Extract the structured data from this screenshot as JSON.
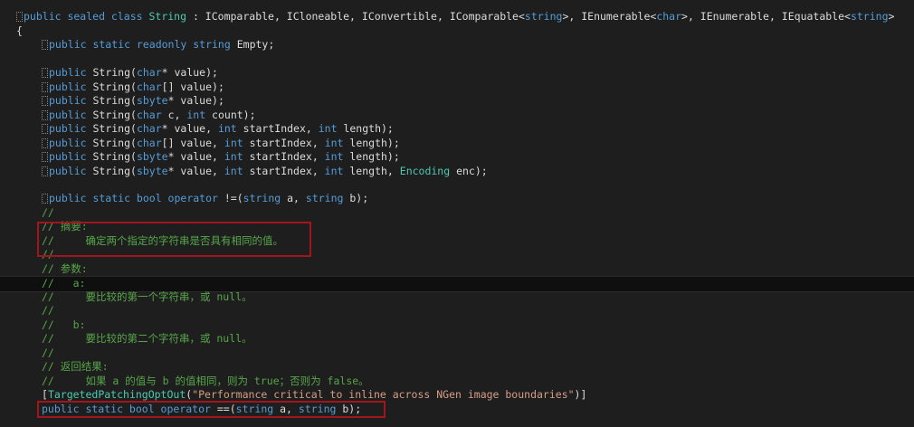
{
  "editor": {
    "lines": [
      {
        "tokens": [
          {
            "t": "public sealed class ",
            "c": "kw"
          },
          {
            "t": "String",
            "c": "type"
          },
          {
            "t": " : IComparable, ICloneable, IConvertible, IComparable<",
            "c": "tx"
          },
          {
            "t": "string",
            "c": "kw"
          },
          {
            "t": ">, IEnumerable<",
            "c": "tx"
          },
          {
            "t": "char",
            "c": "kw"
          },
          {
            "t": ">, IEnumerable, IEquatable<",
            "c": "tx"
          },
          {
            "t": "string",
            "c": "kw"
          },
          {
            "t": ">",
            "c": "tx"
          }
        ]
      },
      {
        "tokens": [
          {
            "t": "{",
            "c": "tx"
          }
        ]
      },
      {
        "tokens": [
          {
            "t": "public static readonly string",
            "c": "kw"
          },
          {
            "t": " Empty;",
            "c": "tx"
          }
        ]
      },
      {
        "tokens": []
      },
      {
        "tokens": [
          {
            "t": "public",
            "c": "kw"
          },
          {
            "t": " String(",
            "c": "tx"
          },
          {
            "t": "char",
            "c": "kw"
          },
          {
            "t": "* value);",
            "c": "tx"
          }
        ]
      },
      {
        "tokens": [
          {
            "t": "public",
            "c": "kw"
          },
          {
            "t": " String(",
            "c": "tx"
          },
          {
            "t": "char",
            "c": "kw"
          },
          {
            "t": "[] value);",
            "c": "tx"
          }
        ]
      },
      {
        "tokens": [
          {
            "t": "public",
            "c": "kw"
          },
          {
            "t": " String(",
            "c": "tx"
          },
          {
            "t": "sbyte",
            "c": "kw"
          },
          {
            "t": "* value);",
            "c": "tx"
          }
        ]
      },
      {
        "tokens": [
          {
            "t": "public",
            "c": "kw"
          },
          {
            "t": " String(",
            "c": "tx"
          },
          {
            "t": "char",
            "c": "kw"
          },
          {
            "t": " c, ",
            "c": "tx"
          },
          {
            "t": "int",
            "c": "kw"
          },
          {
            "t": " count);",
            "c": "tx"
          }
        ]
      },
      {
        "tokens": [
          {
            "t": "public",
            "c": "kw"
          },
          {
            "t": " String(",
            "c": "tx"
          },
          {
            "t": "char",
            "c": "kw"
          },
          {
            "t": "* value, ",
            "c": "tx"
          },
          {
            "t": "int",
            "c": "kw"
          },
          {
            "t": " startIndex, ",
            "c": "tx"
          },
          {
            "t": "int",
            "c": "kw"
          },
          {
            "t": " length);",
            "c": "tx"
          }
        ]
      },
      {
        "tokens": [
          {
            "t": "public",
            "c": "kw"
          },
          {
            "t": " String(",
            "c": "tx"
          },
          {
            "t": "char",
            "c": "kw"
          },
          {
            "t": "[] value, ",
            "c": "tx"
          },
          {
            "t": "int",
            "c": "kw"
          },
          {
            "t": " startIndex, ",
            "c": "tx"
          },
          {
            "t": "int",
            "c": "kw"
          },
          {
            "t": " length);",
            "c": "tx"
          }
        ]
      },
      {
        "tokens": [
          {
            "t": "public",
            "c": "kw"
          },
          {
            "t": " String(",
            "c": "tx"
          },
          {
            "t": "sbyte",
            "c": "kw"
          },
          {
            "t": "* value, ",
            "c": "tx"
          },
          {
            "t": "int",
            "c": "kw"
          },
          {
            "t": " startIndex, ",
            "c": "tx"
          },
          {
            "t": "int",
            "c": "kw"
          },
          {
            "t": " length);",
            "c": "tx"
          }
        ]
      },
      {
        "tokens": [
          {
            "t": "public",
            "c": "kw"
          },
          {
            "t": " String(",
            "c": "tx"
          },
          {
            "t": "sbyte",
            "c": "kw"
          },
          {
            "t": "* value, ",
            "c": "tx"
          },
          {
            "t": "int",
            "c": "kw"
          },
          {
            "t": " startIndex, ",
            "c": "tx"
          },
          {
            "t": "int",
            "c": "kw"
          },
          {
            "t": " length, ",
            "c": "tx"
          },
          {
            "t": "Encoding",
            "c": "type"
          },
          {
            "t": " enc);",
            "c": "tx"
          }
        ]
      },
      {
        "tokens": []
      },
      {
        "tokens": [
          {
            "t": "public static bool operator",
            "c": "kw"
          },
          {
            "t": " !=(",
            "c": "tx"
          },
          {
            "t": "string",
            "c": "kw"
          },
          {
            "t": " a, ",
            "c": "tx"
          },
          {
            "t": "string",
            "c": "kw"
          },
          {
            "t": " b);",
            "c": "tx"
          }
        ]
      },
      {
        "tokens": [
          {
            "t": "//",
            "c": "cm"
          }
        ]
      },
      {
        "tokens": [
          {
            "t": "// 摘要:",
            "c": "cm"
          }
        ]
      },
      {
        "tokens": [
          {
            "t": "//     确定两个指定的字符串是否具有相同的值。",
            "c": "cm"
          }
        ]
      },
      {
        "tokens": [
          {
            "t": "//",
            "c": "cm"
          }
        ]
      },
      {
        "tokens": [
          {
            "t": "// 参数:",
            "c": "cm"
          }
        ]
      },
      {
        "tokens": [
          {
            "t": "//   a:",
            "c": "cm"
          }
        ]
      },
      {
        "tokens": [
          {
            "t": "//     要比较的第一个字符串，或 null。",
            "c": "cm"
          }
        ]
      },
      {
        "tokens": [
          {
            "t": "//",
            "c": "cm"
          }
        ]
      },
      {
        "tokens": [
          {
            "t": "//   b:",
            "c": "cm"
          }
        ]
      },
      {
        "tokens": [
          {
            "t": "//     要比较的第二个字符串，或 null。",
            "c": "cm"
          }
        ]
      },
      {
        "tokens": [
          {
            "t": "//",
            "c": "cm"
          }
        ]
      },
      {
        "tokens": [
          {
            "t": "// 返回结果:",
            "c": "cm"
          }
        ]
      },
      {
        "tokens": [
          {
            "t": "//     如果 a 的值与 b 的值相同，则为 true；否则为 false。",
            "c": "cm"
          }
        ]
      },
      {
        "tokens": [
          {
            "t": "[",
            "c": "tx"
          },
          {
            "t": "TargetedPatchingOptOut",
            "c": "type"
          },
          {
            "t": "(",
            "c": "tx"
          },
          {
            "t": "\"Performance critical to inline across NGen image boundaries\"",
            "c": "str"
          },
          {
            "t": ")]",
            "c": "tx"
          }
        ]
      },
      {
        "tokens": [
          {
            "t": "public static bool operator",
            "c": "kw"
          },
          {
            "t": " ==(",
            "c": "tx"
          },
          {
            "t": "string",
            "c": "kw"
          },
          {
            "t": " a, ",
            "c": "tx"
          },
          {
            "t": "string",
            "c": "kw"
          },
          {
            "t": " b);",
            "c": "tx"
          }
        ]
      }
    ]
  }
}
